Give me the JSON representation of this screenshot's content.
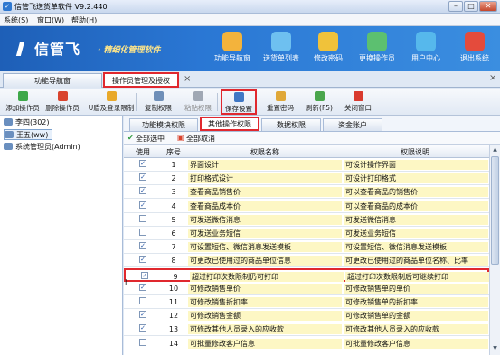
{
  "window": {
    "title": "信管飞送货单软件 V9.2.440",
    "min": "–",
    "max": "□",
    "close": "✕"
  },
  "menu": [
    "系统(S)",
    "窗口(W)",
    "帮助(H)"
  ],
  "banner": {
    "logo": "信管飞",
    "slogan": "· 精细化管理软件",
    "nav": [
      {
        "label": "功能导航窗",
        "icon": "monitor-icon",
        "color": "#f3b33c"
      },
      {
        "label": "送货单列表",
        "icon": "truck-list-icon",
        "color": "#6ec0f0"
      },
      {
        "label": "修改密码",
        "icon": "lock-icon",
        "color": "#f0c23a"
      },
      {
        "label": "更换操作员",
        "icon": "users-icon",
        "color": "#5cc070"
      },
      {
        "label": "用户中心",
        "icon": "globe-icon",
        "color": "#56b8ec"
      },
      {
        "label": "退出系统",
        "icon": "power-icon",
        "color": "#e44b3c"
      }
    ]
  },
  "tabs": [
    {
      "label": "功能导航窗"
    },
    {
      "label": "操作员管理及授权"
    }
  ],
  "tab_close": "×",
  "toolbar": [
    {
      "label": "添加操作员",
      "icon": "add-icon",
      "color": "#3ea84a"
    },
    {
      "label": "删除操作员",
      "icon": "delete-icon",
      "color": "#d9442e"
    },
    {
      "label": "U盾及登录限制",
      "icon": "shield-icon",
      "color": "#e9a92a"
    },
    {
      "label": "复制权限",
      "icon": "copy-icon",
      "color": "#6f8fb8"
    },
    {
      "label": "粘贴权限",
      "icon": "paste-icon",
      "color": "#a0a8b4"
    },
    {
      "label": "保存设置",
      "icon": "save-icon",
      "color": "#3f77c4"
    },
    {
      "label": "重置密码",
      "icon": "key-icon",
      "color": "#e0a838"
    },
    {
      "label": "刷新(F5)",
      "icon": "refresh-icon",
      "color": "#4aa64c"
    },
    {
      "label": "关闭窗口",
      "icon": "close-window-icon",
      "color": "#d93a2e"
    }
  ],
  "operators": [
    "李四(302)",
    "王五(ww)",
    "系统管理员(Admin)"
  ],
  "subtabs": [
    "功能模块权限",
    "其他操作权限",
    "数据权限",
    "资金账户"
  ],
  "actions": {
    "select_all": "全部选中",
    "cancel_all": "全部取消"
  },
  "columns": [
    "使用",
    "序号",
    "权限名称",
    "权限说明"
  ],
  "rows": [
    {
      "checked": true,
      "no": "1",
      "name": "界面设计",
      "desc": "可设计操作界面"
    },
    {
      "checked": true,
      "no": "2",
      "name": "打印格式设计",
      "desc": "可设计打印格式"
    },
    {
      "checked": true,
      "no": "3",
      "name": "查看商品销售价",
      "desc": "可以查看商品的销售价"
    },
    {
      "checked": true,
      "no": "4",
      "name": "查看商品成本价",
      "desc": "可以查看商品的成本价"
    },
    {
      "checked": false,
      "no": "5",
      "name": "可发送微信消息",
      "desc": "可发送微信消息"
    },
    {
      "checked": false,
      "no": "6",
      "name": "可发送业务短信",
      "desc": "可发送业务短信"
    },
    {
      "checked": true,
      "no": "7",
      "name": "可设置短信、微信消息发送模板",
      "desc": "可设置短信、微信消息发送模板"
    },
    {
      "checked": true,
      "no": "8",
      "name": "可更改已使用过的商品单位信息",
      "desc": "可更改已使用过的商品单位名称、比率"
    },
    {
      "checked": true,
      "no": "9",
      "name": "超过打印次数限制仍可打印",
      "desc": "超过打印次数限制后可继续打印"
    },
    {
      "checked": true,
      "no": "10",
      "name": "可修改销售单价",
      "desc": "可修改销售单的单价"
    },
    {
      "checked": false,
      "no": "11",
      "name": "可修改销售折扣率",
      "desc": "可修改销售单的折扣率"
    },
    {
      "checked": true,
      "no": "12",
      "name": "可修改销售金额",
      "desc": "可修改销售单的金额"
    },
    {
      "checked": true,
      "no": "13",
      "name": "可修改其他人员录入的应收款",
      "desc": "可修改其他人员录入的应收款"
    },
    {
      "checked": false,
      "no": "14",
      "name": "可批量修改客户信息",
      "desc": "可批量修改客户信息"
    }
  ],
  "row_cursor": "I"
}
